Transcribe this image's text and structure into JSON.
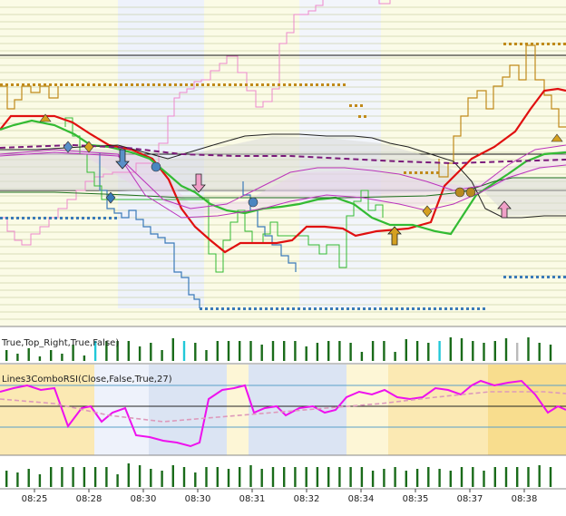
{
  "chart_data": [
    {
      "type": "line",
      "panel": "price",
      "grid": true,
      "reference_levels": [
        61,
        170,
        210
      ],
      "series": [
        {
          "color": "#e01010",
          "values": [
            [
              0,
              143
            ],
            [
              12,
              128
            ],
            [
              35,
              128
            ],
            [
              60,
              128
            ],
            [
              80,
              135
            ],
            [
              100,
              148
            ],
            [
              120,
              160
            ],
            [
              145,
              165
            ],
            [
              168,
              175
            ],
            [
              186,
              198
            ],
            [
              200,
              230
            ],
            [
              215,
              250
            ],
            [
              232,
              265
            ],
            [
              248,
              278
            ],
            [
              265,
              268
            ],
            [
              285,
              268
            ],
            [
              305,
              268
            ],
            [
              322,
              265
            ],
            [
              338,
              250
            ],
            [
              358,
              250
            ],
            [
              378,
              252
            ],
            [
              392,
              260
            ],
            [
              415,
              255
            ],
            [
              450,
              252
            ],
            [
              475,
              245
            ],
            [
              490,
              205
            ],
            [
              505,
              190
            ],
            [
              520,
              175
            ],
            [
              545,
              162
            ],
            [
              568,
              145
            ],
            [
              585,
              120
            ],
            [
              600,
              100
            ],
            [
              615,
              98
            ],
            [
              624,
              100
            ]
          ]
        },
        {
          "color": "#33bb33",
          "values": [
            [
              0,
              143
            ],
            [
              15,
              138
            ],
            [
              35,
              133
            ],
            [
              60,
              138
            ],
            [
              82,
              148
            ],
            [
              100,
              160
            ],
            [
              120,
              162
            ],
            [
              145,
              168
            ],
            [
              165,
              175
            ],
            [
              185,
              192
            ],
            [
              200,
              205
            ],
            [
              215,
              212
            ],
            [
              232,
              225
            ],
            [
              250,
              232
            ],
            [
              270,
              235
            ],
            [
              290,
              230
            ],
            [
              310,
              228
            ],
            [
              330,
              225
            ],
            [
              350,
              220
            ],
            [
              370,
              218
            ],
            [
              390,
              225
            ],
            [
              410,
              240
            ],
            [
              430,
              248
            ],
            [
              455,
              248
            ],
            [
              480,
              255
            ],
            [
              497,
              258
            ],
            [
              510,
              238
            ],
            [
              525,
              215
            ],
            [
              540,
              205
            ],
            [
              560,
              192
            ],
            [
              580,
              178
            ],
            [
              600,
              170
            ],
            [
              624,
              168
            ]
          ]
        },
        {
          "color": "#1d6f1d",
          "values": [
            [
              0,
              212
            ],
            [
              60,
              212
            ],
            [
              140,
              215
            ],
            [
              200,
              218
            ],
            [
              300,
              218
            ],
            [
              380,
              218
            ],
            [
              470,
              216
            ],
            [
              510,
              212
            ],
            [
              545,
              200
            ],
            [
              565,
              196
            ],
            [
              624,
              196
            ]
          ]
        },
        {
          "color": "#222222",
          "values": [
            [
              0,
              165
            ],
            [
              40,
              165
            ],
            [
              90,
              162
            ],
            [
              130,
              160
            ],
            [
              185,
              175
            ],
            [
              235,
              160
            ],
            [
              270,
              150
            ],
            [
              300,
              148
            ],
            [
              330,
              148
            ],
            [
              360,
              150
            ],
            [
              390,
              150
            ],
            [
              410,
              152
            ],
            [
              430,
              158
            ],
            [
              450,
              162
            ],
            [
              475,
              170
            ],
            [
              500,
              178
            ],
            [
              520,
              200
            ],
            [
              535,
              230
            ],
            [
              555,
              240
            ],
            [
              575,
              240
            ],
            [
              600,
              238
            ],
            [
              624,
              238
            ]
          ]
        },
        {
          "color": "#bb33bb",
          "values": [
            [
              0,
              172
            ],
            [
              60,
              168
            ],
            [
              130,
              172
            ],
            [
              180,
              220
            ],
            [
              210,
              230
            ],
            [
              250,
              225
            ],
            [
              290,
              205
            ],
            [
              320,
              190
            ],
            [
              350,
              185
            ],
            [
              380,
              185
            ],
            [
              410,
              188
            ],
            [
              440,
              192
            ],
            [
              470,
              200
            ],
            [
              500,
              210
            ],
            [
              530,
              205
            ],
            [
              560,
              182
            ],
            [
              590,
              165
            ],
            [
              624,
              160
            ]
          ]
        },
        {
          "color": "#bb33bb",
          "values": [
            [
              0,
              170
            ],
            [
              60,
              165
            ],
            [
              130,
              170
            ],
            [
              160,
              215
            ],
            [
              200,
              240
            ],
            [
              240,
              238
            ],
            [
              290,
              230
            ],
            [
              320,
              222
            ],
            [
              360,
              215
            ],
            [
              400,
              218
            ],
            [
              440,
              225
            ],
            [
              470,
              232
            ],
            [
              500,
              225
            ],
            [
              530,
              212
            ],
            [
              560,
              196
            ],
            [
              595,
              185
            ],
            [
              624,
              182
            ]
          ]
        },
        {
          "color": "#7a1a7a",
          "dashed": true,
          "values": [
            [
              0,
              163
            ],
            [
              80,
              160
            ],
            [
              140,
              163
            ],
            [
              200,
              170
            ],
            [
              260,
              172
            ],
            [
              320,
              172
            ],
            [
              380,
              175
            ],
            [
              440,
              178
            ],
            [
              500,
              180
            ],
            [
              560,
              178
            ],
            [
              624,
              176
            ]
          ]
        }
      ]
    },
    {
      "type": "bar",
      "panel": "volume",
      "text_label": "True,Top_Right,True,False)",
      "values": [
        12,
        22,
        8,
        22,
        14,
        22,
        5,
        22,
        12,
        22,
        8,
        22,
        18,
        22,
        6,
        22,
        22,
        10,
        22,
        14,
        22,
        18,
        22,
        20,
        16,
        22,
        20,
        22,
        12,
        22,
        25,
        22,
        22,
        16,
        20,
        22,
        12,
        22,
        22,
        18,
        22,
        20,
        22,
        14,
        22,
        22,
        18,
        25,
        22,
        12,
        22,
        14,
        22,
        22,
        16,
        22,
        20,
        22,
        22,
        12,
        22,
        22,
        20,
        22,
        10,
        22,
        22,
        6,
        22,
        22,
        10,
        26,
        24,
        14,
        22,
        22,
        20,
        25,
        22,
        22,
        26,
        22,
        25,
        18,
        22,
        22,
        20,
        24,
        22,
        22,
        25,
        22,
        20,
        22,
        26,
        22,
        20,
        24,
        18,
        25
      ],
      "colors": [
        "g",
        "g",
        "g",
        "g",
        "g",
        "g",
        "g",
        "g",
        "g",
        "g",
        "g",
        "g",
        "g",
        "g",
        "g",
        "c",
        "c",
        "g",
        "g",
        "g",
        "g",
        "g",
        "g",
        "g",
        "g",
        "g",
        "g",
        "g",
        "g",
        "g",
        "g",
        "g",
        "c",
        "g",
        "g",
        "g",
        "g",
        "g",
        "g",
        "g",
        "g",
        "g",
        "g",
        "g",
        "g",
        "g",
        "g",
        "g",
        "g",
        "g",
        "g",
        "g",
        "g",
        "g",
        "g",
        "l",
        "g",
        "g",
        "g",
        "g",
        "g",
        "g",
        "g",
        "g",
        "g",
        "g",
        "g",
        "c",
        "g",
        "g",
        "g",
        "g",
        "g",
        "g",
        "g",
        "g",
        "g",
        "g",
        "c",
        "c",
        "g",
        "g",
        "g",
        "g",
        "g",
        "g",
        "g",
        "g",
        "g",
        "g",
        "g",
        "g",
        "l",
        "g",
        "g",
        "g",
        "g",
        "g",
        "g",
        "r"
      ]
    },
    {
      "type": "line",
      "panel": "rsi",
      "text_label": "Lines3ComboRSI(Close,False,True,27)",
      "series": [
        {
          "color": "#ee11ee",
          "values": [
            [
              0,
              432
            ],
            [
              15,
              428
            ],
            [
              30,
              425
            ],
            [
              45,
              430
            ],
            [
              60,
              428
            ],
            [
              75,
              470
            ],
            [
              90,
              450
            ],
            [
              100,
              448
            ],
            [
              112,
              465
            ],
            [
              124,
              455
            ],
            [
              138,
              450
            ],
            [
              150,
              480
            ],
            [
              165,
              482
            ],
            [
              180,
              486
            ],
            [
              195,
              488
            ],
            [
              210,
              492
            ],
            [
              220,
              488
            ],
            [
              230,
              440
            ],
            [
              245,
              430
            ],
            [
              258,
              428
            ],
            [
              270,
              425
            ],
            [
              280,
              455
            ],
            [
              292,
              450
            ],
            [
              305,
              448
            ],
            [
              315,
              458
            ],
            [
              330,
              450
            ],
            [
              345,
              448
            ],
            [
              358,
              455
            ],
            [
              370,
              452
            ],
            [
              382,
              438
            ],
            [
              396,
              432
            ],
            [
              410,
              435
            ],
            [
              424,
              430
            ],
            [
              438,
              438
            ],
            [
              452,
              440
            ],
            [
              466,
              438
            ],
            [
              480,
              428
            ],
            [
              494,
              430
            ],
            [
              508,
              435
            ],
            [
              520,
              425
            ],
            [
              530,
              420
            ],
            [
              545,
              425
            ],
            [
              560,
              422
            ],
            [
              575,
              420
            ],
            [
              590,
              435
            ],
            [
              604,
              455
            ],
            [
              615,
              448
            ],
            [
              624,
              452
            ]
          ]
        },
        {
          "color": "#dd99bb",
          "dashed": true,
          "values": [
            [
              0,
              440
            ],
            [
              60,
              445
            ],
            [
              120,
              458
            ],
            [
              180,
              465
            ],
            [
              240,
              460
            ],
            [
              300,
              455
            ],
            [
              360,
              450
            ],
            [
              420,
              445
            ],
            [
              480,
              438
            ],
            [
              540,
              432
            ],
            [
              600,
              432
            ],
            [
              624,
              434
            ]
          ]
        }
      ]
    },
    {
      "type": "bar",
      "panel": "volume2",
      "values": [
        18,
        22,
        16,
        22,
        20,
        22,
        14,
        18,
        22,
        20,
        22,
        18,
        22,
        20,
        22,
        16,
        22,
        24,
        22,
        20,
        14,
        22,
        26,
        22,
        24,
        22,
        20,
        22,
        18,
        22,
        24,
        20,
        22,
        22,
        16,
        24,
        22,
        18,
        22,
        24,
        20,
        22,
        22,
        18,
        24,
        22,
        20,
        22,
        22,
        14,
        22,
        24,
        22,
        18,
        22,
        20,
        22,
        24,
        22,
        18,
        22,
        20,
        22,
        24,
        22,
        22,
        18,
        22,
        20,
        24,
        22,
        22,
        18,
        22,
        20,
        24,
        22,
        22,
        20,
        22,
        18,
        24,
        22,
        20,
        22,
        22,
        18,
        24,
        22,
        20,
        22,
        24,
        22,
        18,
        22,
        20,
        24,
        22,
        22,
        20
      ],
      "x_tick_labels": [
        "08:25",
        "08:28",
        "08:30",
        "08:30",
        "08:31",
        "08:32",
        "08:34",
        "08:35",
        "08:37",
        "08:38"
      ]
    }
  ]
}
